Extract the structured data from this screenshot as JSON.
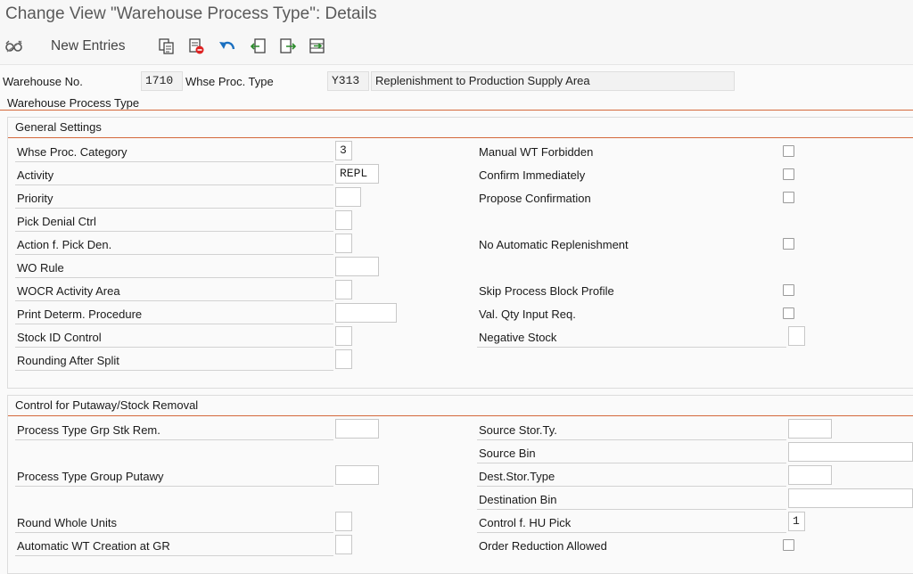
{
  "window": {
    "title": "Change View \"Warehouse Process Type\": Details"
  },
  "toolbar": {
    "new_entries_label": "New Entries",
    "icons": [
      "glasses-display-change-icon",
      "copy-as-icon",
      "delete-icon",
      "undo-icon",
      "previous-entry-icon",
      "next-entry-icon",
      "select-all-icon"
    ]
  },
  "header": {
    "warehouse_label": "Warehouse No.",
    "warehouse_value": "1710",
    "proc_type_label": "Whse Proc. Type",
    "proc_type_value": "Y313",
    "proc_type_desc": "Replenishment to Production Supply Area"
  },
  "tab": {
    "label": "Warehouse Process Type"
  },
  "general": {
    "title": "General Settings",
    "left": [
      {
        "label": "Whse Proc. Category",
        "value": "3"
      },
      {
        "label": "Activity",
        "value": "REPL"
      },
      {
        "label": "Priority",
        "value": ""
      },
      {
        "label": "Pick Denial Ctrl",
        "value": ""
      },
      {
        "label": "Action f. Pick Den.",
        "value": ""
      },
      {
        "label": "WO Rule",
        "value": ""
      },
      {
        "label": "WOCR Activity Area",
        "value": ""
      },
      {
        "label": "Print Determ. Procedure",
        "value": ""
      },
      {
        "label": "Stock ID Control",
        "value": ""
      },
      {
        "label": "Rounding After Split",
        "value": ""
      }
    ],
    "right": [
      {
        "label": "Manual WT Forbidden",
        "checked": false
      },
      {
        "label": "Confirm Immediately",
        "checked": false
      },
      {
        "label": "Propose Confirmation",
        "checked": false
      },
      {
        "label": "No Automatic Replenishment",
        "checked": false
      },
      {
        "label": "Skip Process Block Profile",
        "checked": false
      },
      {
        "label": "Val. Qty Input Req.",
        "checked": false
      },
      {
        "label": "Negative Stock",
        "value": ""
      }
    ]
  },
  "putaway": {
    "title": "Control for Putaway/Stock Removal",
    "left": [
      {
        "label": "Process Type Grp Stk Rem.",
        "value": ""
      },
      {
        "label": "Process Type Group Putawy",
        "value": ""
      },
      {
        "label": "Round Whole Units",
        "value": ""
      },
      {
        "label": "Automatic WT Creation at GR",
        "value": ""
      }
    ],
    "right": [
      {
        "label": "Source Stor.Ty.",
        "value": ""
      },
      {
        "label": "Source Bin",
        "value": ""
      },
      {
        "label": "Dest.Stor.Type",
        "value": ""
      },
      {
        "label": "Destination Bin",
        "value": ""
      },
      {
        "label": "Control f. HU Pick",
        "value": "1"
      },
      {
        "label": "Order Reduction Allowed",
        "checked": false
      }
    ]
  }
}
